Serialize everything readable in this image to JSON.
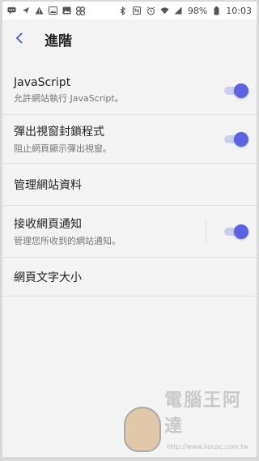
{
  "status_bar": {
    "left_icons": [
      "message-icon",
      "navigation-icon",
      "warning-icon",
      "image-icon",
      "gallery-icon",
      "fan-icon"
    ],
    "right_icons": [
      "bluetooth-icon",
      "nfc-icon",
      "alarm-icon",
      "wifi-icon",
      "signal-icon"
    ],
    "battery": "98%",
    "time": "10:03"
  },
  "header": {
    "title": "進階",
    "back_icon": "chevron-left-icon"
  },
  "settings": [
    {
      "title": "JavaScript",
      "subtitle": "允許網站執行 JavaScript。",
      "toggle": true,
      "on": true
    },
    {
      "title": "彈出視窗封鎖程式",
      "subtitle": "阻止網頁顯示彈出視窗。",
      "toggle": true,
      "on": true
    },
    {
      "title": "管理網站資料",
      "subtitle": "",
      "toggle": false
    },
    {
      "title": "接收網頁通知",
      "subtitle": "管理您所收到的網站通知。",
      "toggle": true,
      "on": true
    },
    {
      "title": "網頁文字大小",
      "subtitle": "",
      "toggle": false
    }
  ],
  "watermark": {
    "text": "電腦王阿達",
    "url": "http://www.kocpc.com.tw"
  },
  "colors": {
    "accent": "#5b63e0",
    "accent_track": "#c9cdee",
    "background": "#f3f3f3"
  }
}
